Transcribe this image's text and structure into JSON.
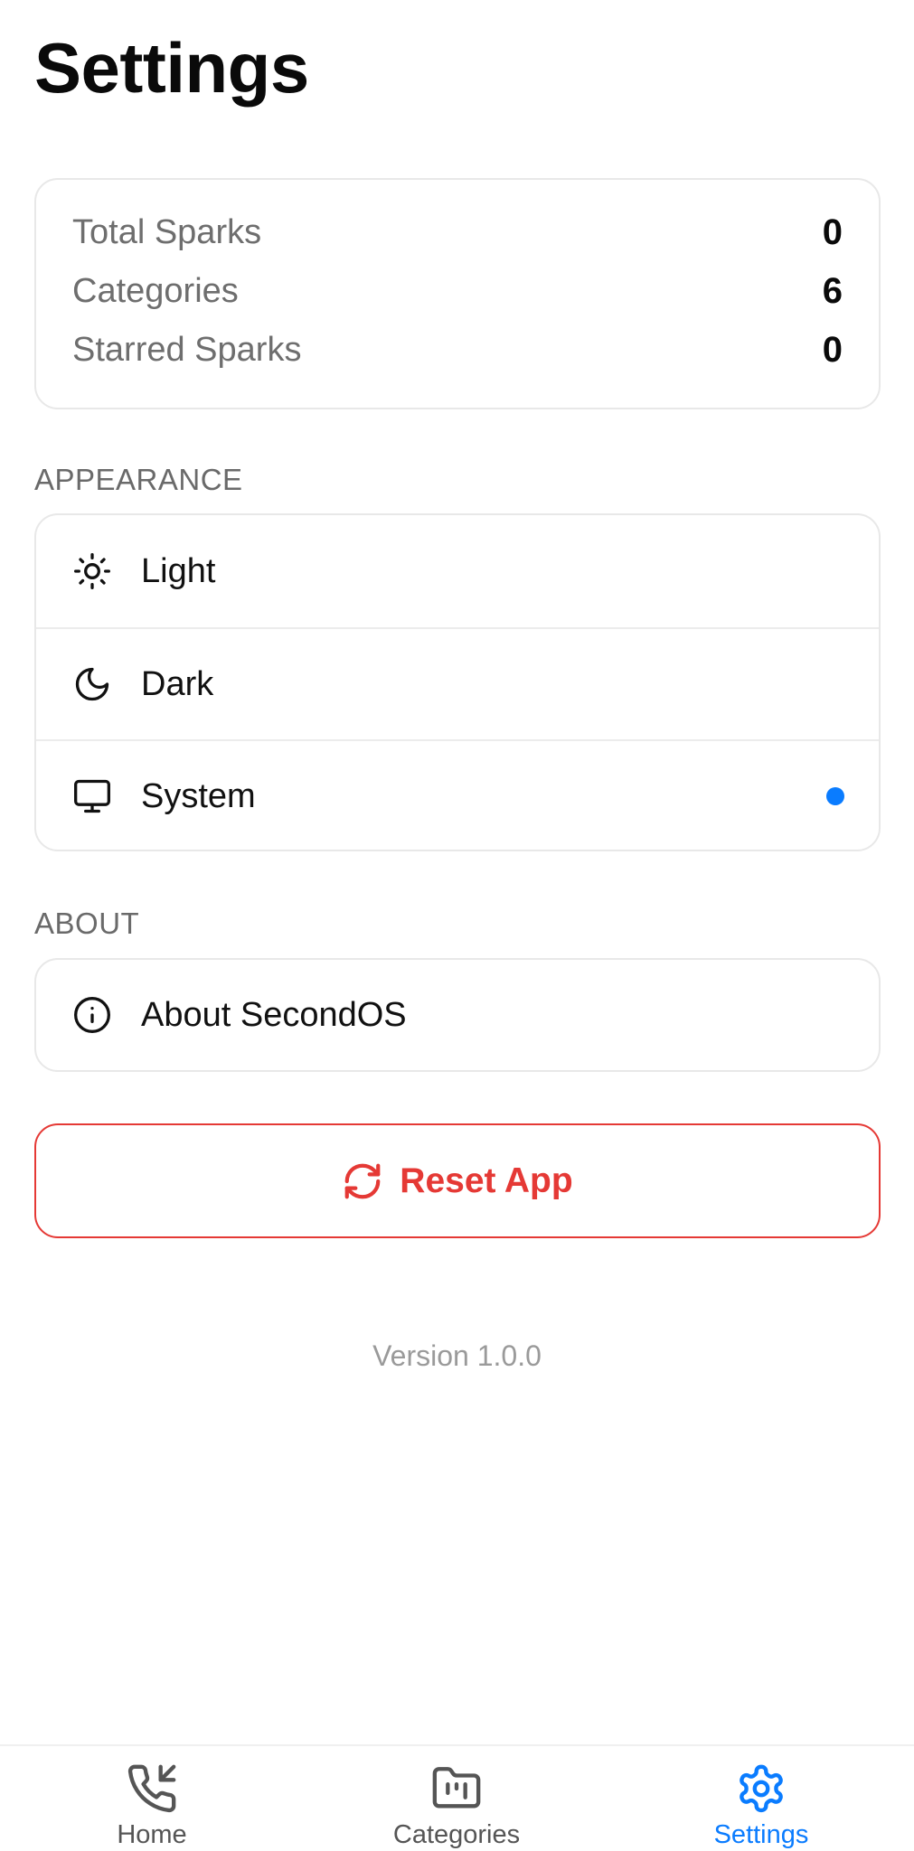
{
  "header": {
    "title": "Settings"
  },
  "stats": [
    {
      "label": "Total Sparks",
      "value": "0"
    },
    {
      "label": "Categories",
      "value": "6"
    },
    {
      "label": "Starred Sparks",
      "value": "0"
    }
  ],
  "appearance": {
    "section_label": "APPEARANCE",
    "options": [
      {
        "label": "Light",
        "icon": "sun-icon"
      },
      {
        "label": "Dark",
        "icon": "moon-icon"
      },
      {
        "label": "System",
        "icon": "monitor-icon"
      }
    ],
    "selected": "System"
  },
  "about": {
    "section_label": "ABOUT",
    "item_label": "About SecondOS",
    "icon": "info-icon"
  },
  "reset": {
    "label": "Reset App",
    "icon": "refresh-icon"
  },
  "version": "Version 1.0.0",
  "tab_bar": {
    "tabs": [
      {
        "label": "Home",
        "icon": "phone-incoming-icon"
      },
      {
        "label": "Categories",
        "icon": "folder-icon"
      },
      {
        "label": "Settings",
        "icon": "gear-icon"
      }
    ],
    "active": "Settings"
  },
  "colors": {
    "accent": "#0a7cff",
    "danger": "#e53935",
    "muted_text": "#6e6e6e",
    "border": "#e8e8e8"
  }
}
